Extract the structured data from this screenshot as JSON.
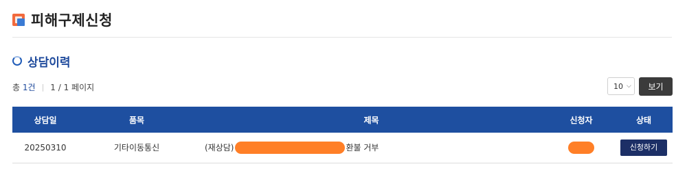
{
  "page": {
    "title": "피해구제신청"
  },
  "section": {
    "title": "상담이력"
  },
  "summary": {
    "total_prefix": "총",
    "total_count": "1건",
    "page_info": "1 / 1 페이지"
  },
  "controls": {
    "per_page_value": "10",
    "view_button": "보기"
  },
  "table": {
    "headers": [
      "상담일",
      "품목",
      "제목",
      "신청자",
      "상태"
    ],
    "rows": [
      {
        "date": "20250310",
        "item": "기타이동통신",
        "title_prefix": "(재상담)",
        "title_suffix": "환불 거부",
        "status_button": "신청하기"
      }
    ]
  },
  "colors": {
    "header_bg": "#1e4fa0",
    "accent": "#1e4a9c",
    "redaction": "#ff7f27",
    "apply_button": "#1c2f66"
  }
}
